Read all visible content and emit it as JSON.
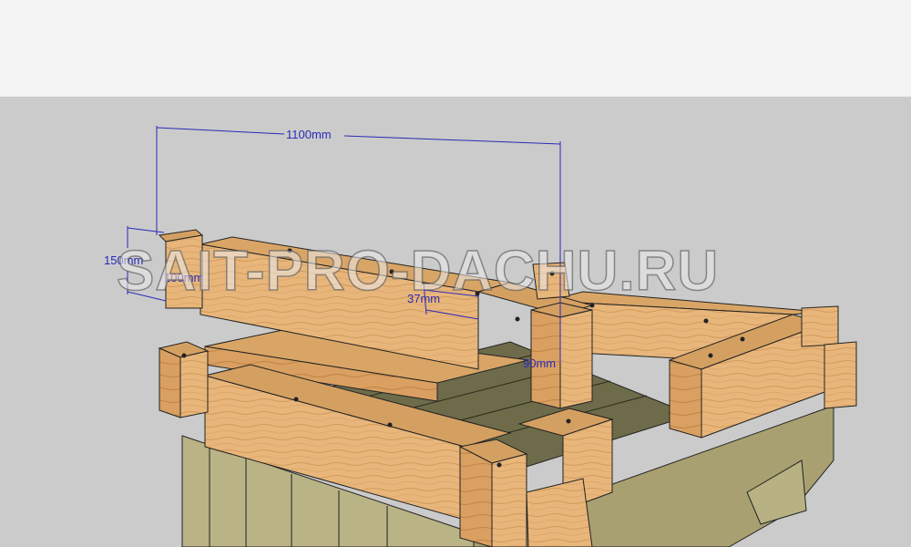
{
  "dimensions": {
    "length": "1100mm",
    "height": "150mm",
    "width": "100mm",
    "recess": "37mm",
    "post": "90mm"
  },
  "watermark": "SAIT-PRO-DACHU.RU",
  "colors": {
    "background": "#cbcbcb",
    "sky": "#f3f3f3",
    "wood": "#e8b67a",
    "wood_dark": "#c98d4f",
    "base_wood": "#b9b386",
    "dimension_line": "#2a2ab8"
  }
}
